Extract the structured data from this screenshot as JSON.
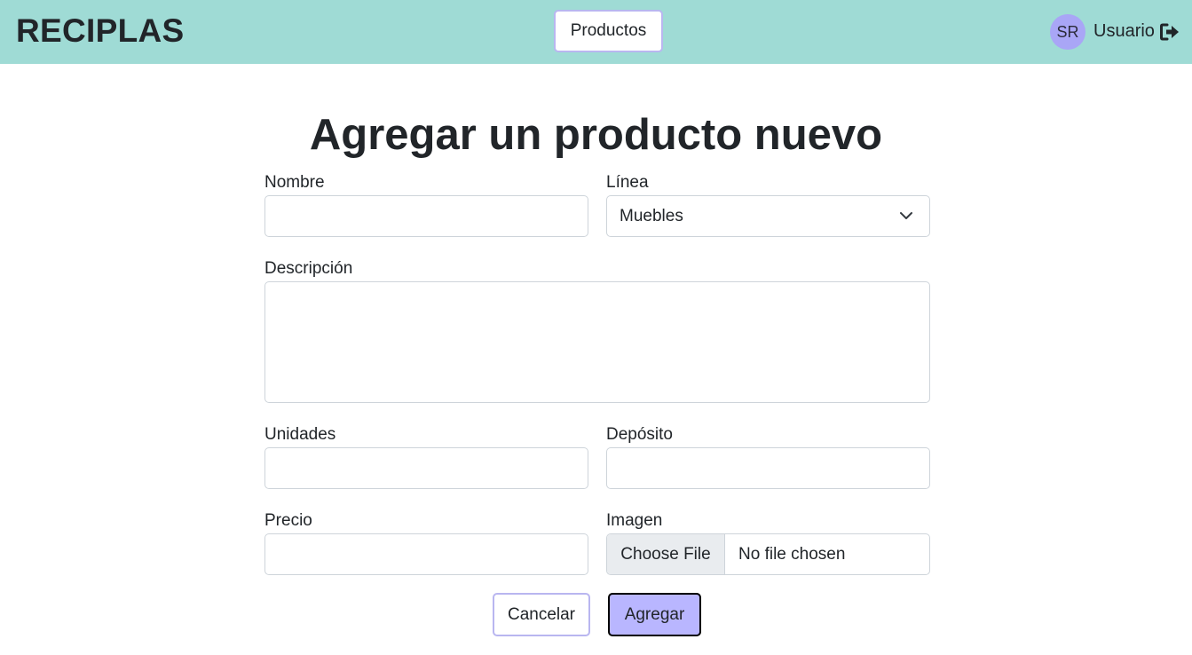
{
  "header": {
    "brand": "RECIPLAS",
    "nav_label": "Productos",
    "avatar_initials": "SR",
    "user_name": "Usuario",
    "logout_icon": "logout-icon",
    "bg_color": "#9fdbd5"
  },
  "form": {
    "title": "Agregar un producto nuevo",
    "nombre": {
      "label": "Nombre",
      "value": ""
    },
    "linea": {
      "label": "Línea",
      "selected": "Muebles"
    },
    "descripcion": {
      "label": "Descripción",
      "value": ""
    },
    "unidades": {
      "label": "Unidades",
      "value": ""
    },
    "deposito": {
      "label": "Depósito",
      "value": ""
    },
    "precio": {
      "label": "Precio",
      "value": ""
    },
    "imagen": {
      "label": "Imagen",
      "button": "Choose File",
      "status": "No file chosen"
    },
    "cancel_label": "Cancelar",
    "submit_label": "Agregar",
    "accent_color": "#b9b6ff"
  }
}
